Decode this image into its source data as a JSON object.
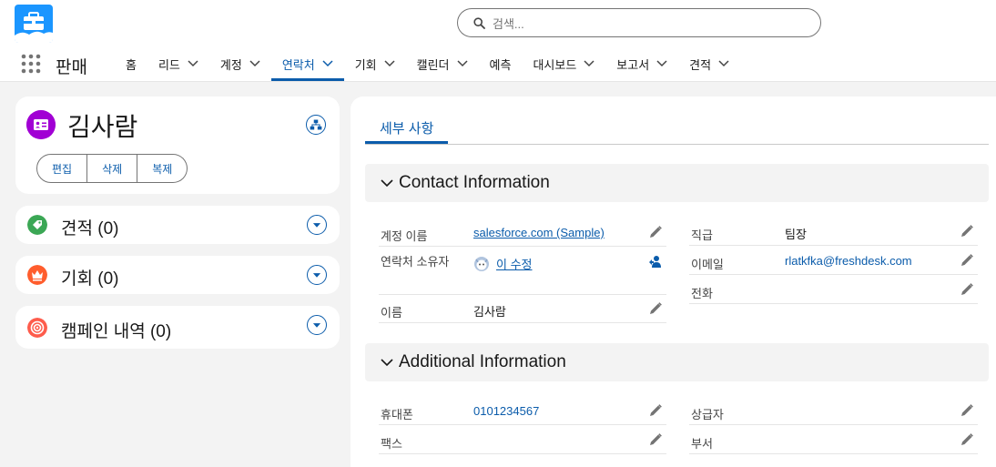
{
  "header": {
    "search_placeholder": "검색...",
    "app_name": "판매",
    "nav": [
      {
        "label": "홈",
        "has_menu": false
      },
      {
        "label": "리드",
        "has_menu": true
      },
      {
        "label": "계정",
        "has_menu": true
      },
      {
        "label": "연락처",
        "has_menu": true,
        "active": true
      },
      {
        "label": "기회",
        "has_menu": true
      },
      {
        "label": "캘린더",
        "has_menu": true
      },
      {
        "label": "예측",
        "has_menu": false
      },
      {
        "label": "대시보드",
        "has_menu": true
      },
      {
        "label": "보고서",
        "has_menu": true
      },
      {
        "label": "견적",
        "has_menu": true
      }
    ]
  },
  "contact": {
    "name": "김사람",
    "actions": {
      "edit": "편집",
      "delete": "삭제",
      "clone": "복제"
    }
  },
  "related": [
    {
      "label": "견적",
      "count": "(0)",
      "icon": "quote-icon",
      "color": "#3ba755"
    },
    {
      "label": "기회",
      "count": "(0)",
      "icon": "opportunity-icon",
      "color": "#ff5d2d"
    },
    {
      "label": "캠페인 내역",
      "count": "(0)",
      "icon": "campaign-icon",
      "color": "#fe5c4c"
    }
  ],
  "details": {
    "tab": "세부 사항",
    "contact_info": {
      "title": "Contact Information",
      "account_name_label": "계정 이름",
      "account_name": "salesforce.com (Sample)",
      "owner_label": "연락처 소유자",
      "owner": "이 수정",
      "name_label": "이름",
      "name": "김사람",
      "title_label": "직급",
      "title_value": "팀장",
      "email_label": "이메일",
      "email": "rlatkfka@freshdesk.com",
      "phone_label": "전화",
      "phone": ""
    },
    "additional_info": {
      "title": "Additional Information",
      "mobile_label": "휴대폰",
      "mobile": "0101234567",
      "fax_label": "팩스",
      "fax": "",
      "reports_to_label": "상급자",
      "reports_to": "",
      "department_label": "부서",
      "department": ""
    }
  },
  "colors": {
    "brand": "#0b5cab",
    "contact_icon": "#a100d4",
    "logo": "#1b96ff"
  }
}
